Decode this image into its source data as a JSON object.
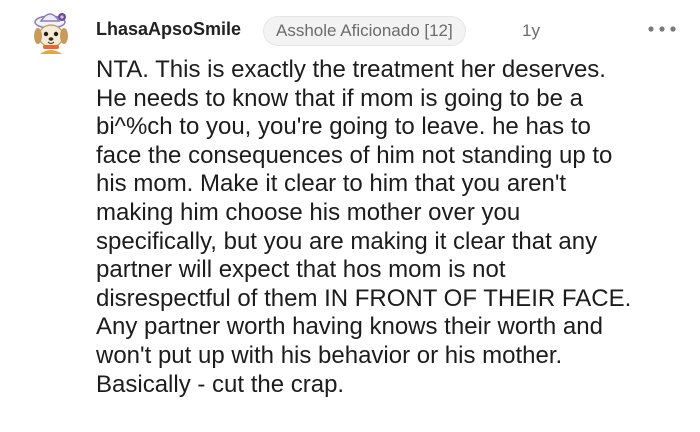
{
  "comment": {
    "username": "LhasaApsoSmile",
    "flair": "Asshole Aficionado [12]",
    "age": "1y",
    "more_icon": "more-horizontal-icon",
    "avatar_icon": "avatar-dog-with-hat",
    "lines": [
      "NTA. This is exactly the treatment her deserves.",
      "He needs to know that if mom is going to be a",
      "bi^%ch to you, you're going to leave. he has to",
      "face the consequences of him not standing up to",
      "his mom. Make it clear to him that you aren't",
      "making him choose his mother over you",
      "specifically, but you are making it clear that any",
      "partner will expect that hos mom is not",
      "disrespectful of them IN FRONT OF THEIR FACE.",
      "Any partner worth having knows their worth and",
      "won't put up with his behavior or his mother.",
      "Basically - cut the crap."
    ]
  }
}
